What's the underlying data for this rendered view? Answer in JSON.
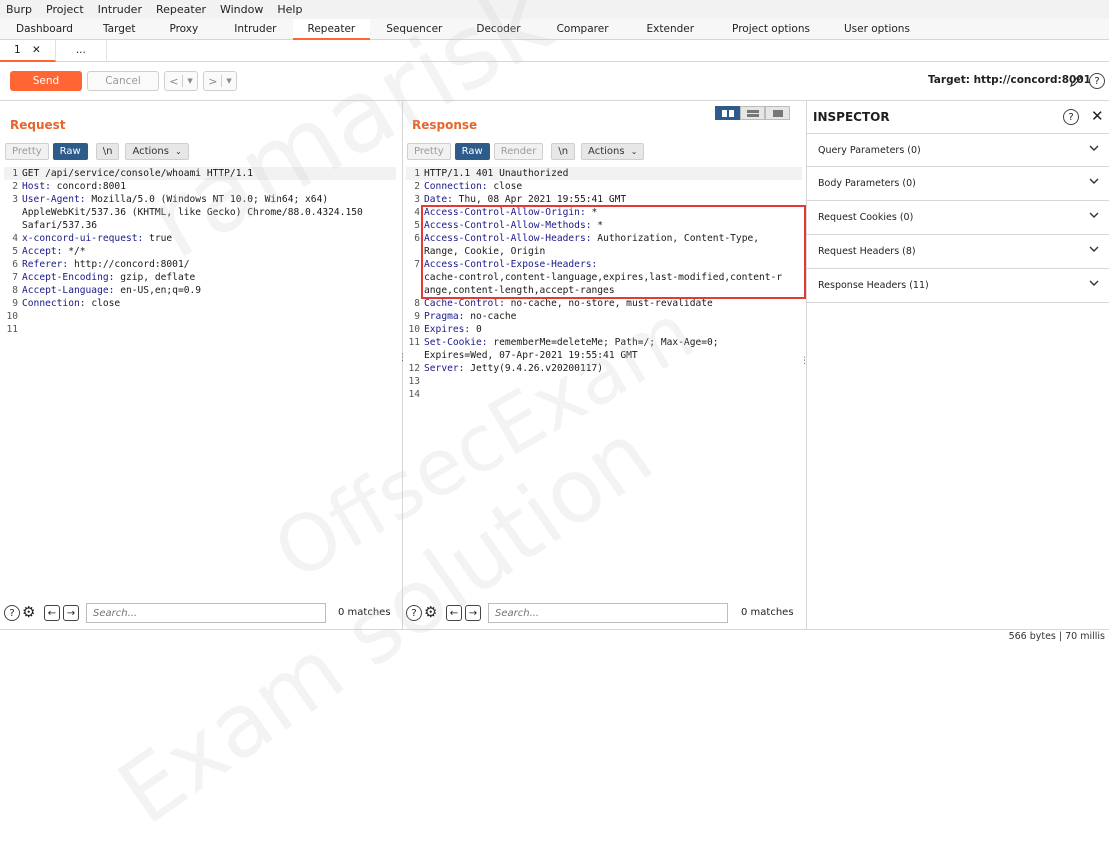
{
  "menu": [
    "Burp",
    "Project",
    "Intruder",
    "Repeater",
    "Window",
    "Help"
  ],
  "main_tabs": [
    "Dashboard",
    "Target",
    "Proxy",
    "Intruder",
    "Repeater",
    "Sequencer",
    "Decoder",
    "Comparer",
    "Extender",
    "Project options",
    "User options"
  ],
  "repeater_tabs": [
    "1",
    "..."
  ],
  "toolbar": {
    "send": "Send",
    "cancel": "Cancel",
    "back": "<",
    "forward": ">",
    "target": "Target: http://concord:8001"
  },
  "request": {
    "title": "Request",
    "formats": [
      "Pretty",
      "Raw",
      "\\n",
      "Actions"
    ],
    "active_format": "Raw",
    "lines": [
      {
        "n": "1",
        "h": "",
        "v": "GET /api/service/console/whoami HTTP/1.1"
      },
      {
        "n": "2",
        "h": "Host:",
        "v": " concord:8001"
      },
      {
        "n": "3",
        "h": "User-Agent:",
        "v": " Mozilla/5.0 (Windows NT 10.0; Win64; x64)"
      },
      {
        "n": "",
        "h": "",
        "v": "AppleWebKit/537.36 (KHTML, like Gecko) Chrome/88.0.4324.150"
      },
      {
        "n": "",
        "h": "",
        "v": "Safari/537.36"
      },
      {
        "n": "4",
        "h": "x-concord-ui-request:",
        "v": " true"
      },
      {
        "n": "5",
        "h": "Accept:",
        "v": " */*"
      },
      {
        "n": "6",
        "h": "Referer:",
        "v": " http://concord:8001/"
      },
      {
        "n": "7",
        "h": "Accept-Encoding:",
        "v": " gzip, deflate"
      },
      {
        "n": "8",
        "h": "Accept-Language:",
        "v": " en-US,en;q=0.9"
      },
      {
        "n": "9",
        "h": "Connection:",
        "v": " close"
      },
      {
        "n": "10",
        "h": "",
        "v": ""
      },
      {
        "n": "11",
        "h": "",
        "v": ""
      }
    ],
    "search_placeholder": "Search...",
    "matches": "0 matches"
  },
  "response": {
    "title": "Response",
    "formats": [
      "Pretty",
      "Raw",
      "Render",
      "\\n",
      "Actions"
    ],
    "active_format": "Raw",
    "lines": [
      {
        "n": "1",
        "h": "",
        "v": "HTTP/1.1 401 Unauthorized"
      },
      {
        "n": "2",
        "h": "Connection:",
        "v": " close"
      },
      {
        "n": "3",
        "h": "Date:",
        "v": " Thu, 08 Apr 2021 19:55:41 GMT"
      },
      {
        "n": "4",
        "h": "Access-Control-Allow-Origin:",
        "v": " *"
      },
      {
        "n": "5",
        "h": "Access-Control-Allow-Methods:",
        "v": " *"
      },
      {
        "n": "6",
        "h": "Access-Control-Allow-Headers:",
        "v": " Authorization, Content-Type,"
      },
      {
        "n": "",
        "h": "",
        "v": "Range, Cookie, Origin"
      },
      {
        "n": "7",
        "h": "Access-Control-Expose-Headers:",
        "v": ""
      },
      {
        "n": "",
        "h": "",
        "v": "cache-control,content-language,expires,last-modified,content-r"
      },
      {
        "n": "",
        "h": "",
        "v": "ange,content-length,accept-ranges"
      },
      {
        "n": "8",
        "h": "Cache-Control:",
        "v": " no-cache, no-store, must-revalidate"
      },
      {
        "n": "9",
        "h": "Pragma:",
        "v": " no-cache"
      },
      {
        "n": "10",
        "h": "Expires:",
        "v": " 0"
      },
      {
        "n": "11",
        "h": "Set-Cookie:",
        "v": " rememberMe=deleteMe; Path=/; Max-Age=0;"
      },
      {
        "n": "",
        "h": "",
        "v": "Expires=Wed, 07-Apr-2021 19:55:41 GMT"
      },
      {
        "n": "12",
        "h": "Server:",
        "v": " Jetty(9.4.26.v20200117)"
      },
      {
        "n": "13",
        "h": "",
        "v": ""
      },
      {
        "n": "14",
        "h": "",
        "v": ""
      }
    ],
    "search_placeholder": "Search...",
    "matches": "0 matches"
  },
  "inspector": {
    "title": "INSPECTOR",
    "sections": [
      "Query Parameters (0)",
      "Body Parameters (0)",
      "Request Cookies (0)",
      "Request Headers (8)",
      "Response Headers (11)"
    ]
  },
  "status": "566 bytes | 70 millis",
  "watermarks": [
    "ramarisk",
    "OffsecExam",
    "Exam solution"
  ],
  "colors": {
    "accent": "#ff6633",
    "active_blue": "#2e5c8a",
    "highlight_red": "#e53935"
  }
}
